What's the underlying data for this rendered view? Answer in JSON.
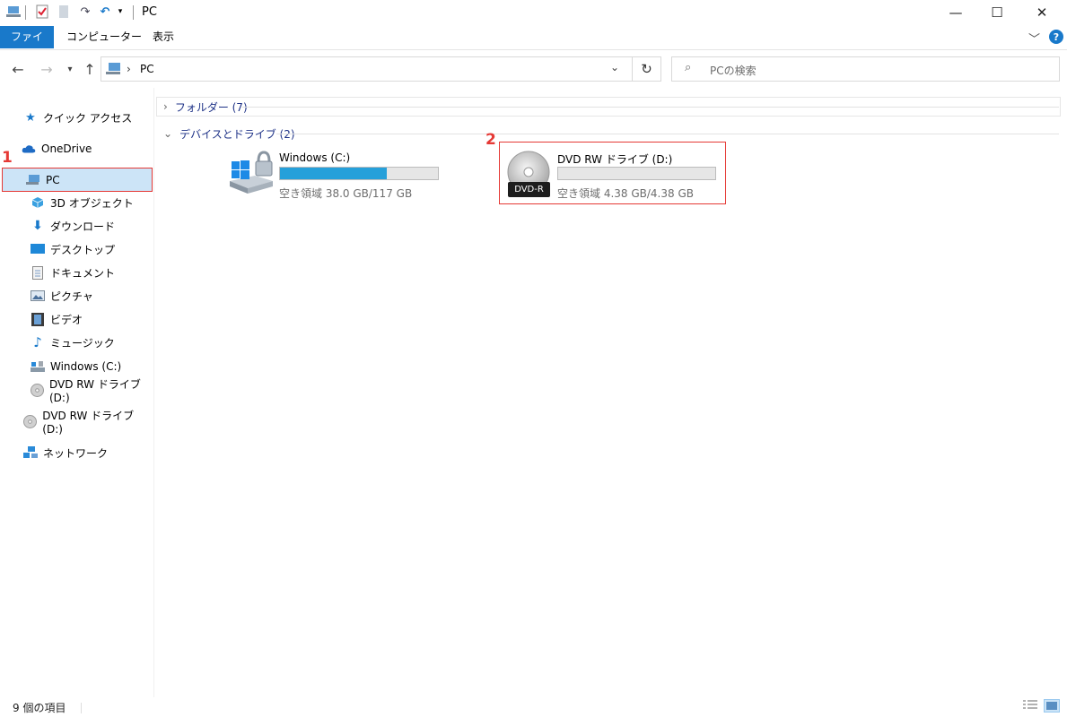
{
  "window": {
    "title": "PC",
    "minimize": "—",
    "maximize": "☐",
    "close": "✕"
  },
  "ribbon": {
    "tabs": [
      {
        "label": "ファイル"
      },
      {
        "label": "コンピューター"
      },
      {
        "label": "表示"
      }
    ],
    "help": "?"
  },
  "address": {
    "path": "PC",
    "search_placeholder": "PCの検索"
  },
  "sidebar": {
    "items": [
      {
        "label": "クイック アクセス",
        "icon": "star-icon"
      },
      {
        "label": "OneDrive",
        "icon": "cloud-icon"
      },
      {
        "label": "PC",
        "icon": "computer-icon",
        "selected": true
      },
      {
        "label": "3D オブジェクト",
        "icon": "cube-icon"
      },
      {
        "label": "ダウンロード",
        "icon": "download-icon"
      },
      {
        "label": "デスクトップ",
        "icon": "desktop-icon"
      },
      {
        "label": "ドキュメント",
        "icon": "document-icon"
      },
      {
        "label": "ピクチャ",
        "icon": "picture-icon"
      },
      {
        "label": "ビデオ",
        "icon": "video-icon"
      },
      {
        "label": "ミュージック",
        "icon": "music-icon"
      },
      {
        "label": "Windows (C:)",
        "icon": "drive-icon"
      },
      {
        "label": "DVD RW ドライブ (D:)",
        "icon": "dvd-icon"
      },
      {
        "label": "DVD RW ドライブ (D:)",
        "icon": "dvd-icon"
      },
      {
        "label": "ネットワーク",
        "icon": "network-icon"
      }
    ]
  },
  "content": {
    "folders_header": "フォルダー (7)",
    "devices_header": "デバイスとドライブ (2)",
    "drives": [
      {
        "name": "Windows (C:)",
        "free": "空き領域 38.0 GB/117 GB",
        "used_fraction": 0.675
      },
      {
        "name": "DVD RW ドライブ (D:)",
        "free": "空き領域 4.38 GB/4.38 GB",
        "used_fraction": 0.0,
        "disc_label": "DVD-R"
      }
    ]
  },
  "annotations": {
    "label1": "1",
    "label2": "2",
    "color": "#e53935"
  },
  "status": {
    "count": "9 個の項目"
  }
}
